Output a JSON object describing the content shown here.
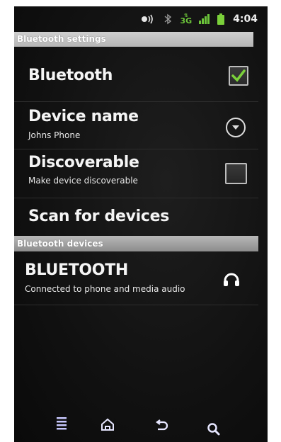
{
  "status_bar": {
    "time": "4:04",
    "network_label": "3G",
    "icons": [
      "vibrate-ringer-icon",
      "bluetooth-icon",
      "3g-data-icon",
      "signal-strength-icon",
      "battery-icon"
    ]
  },
  "header": {
    "title": "Bluetooth settings"
  },
  "settings": {
    "bluetooth": {
      "title": "Bluetooth",
      "checked": true
    },
    "device_name": {
      "title": "Device name",
      "subtitle": "Johns Phone"
    },
    "discoverable": {
      "title": "Discoverable",
      "subtitle": "Make device discoverable",
      "checked": false
    },
    "scan": {
      "title": "Scan for devices"
    }
  },
  "devices_section": {
    "title": "Bluetooth devices",
    "items": [
      {
        "name": "BLUETOOTH",
        "status": "Connected to phone and media audio",
        "icon": "headphones-icon"
      }
    ]
  },
  "nav_bar": {
    "buttons": [
      "menu-icon",
      "home-icon",
      "back-icon",
      "search-icon"
    ]
  },
  "colors": {
    "check_green": "#7bd13a",
    "header_gray": "#b5b5b5",
    "network_green": "#6cc43a"
  }
}
